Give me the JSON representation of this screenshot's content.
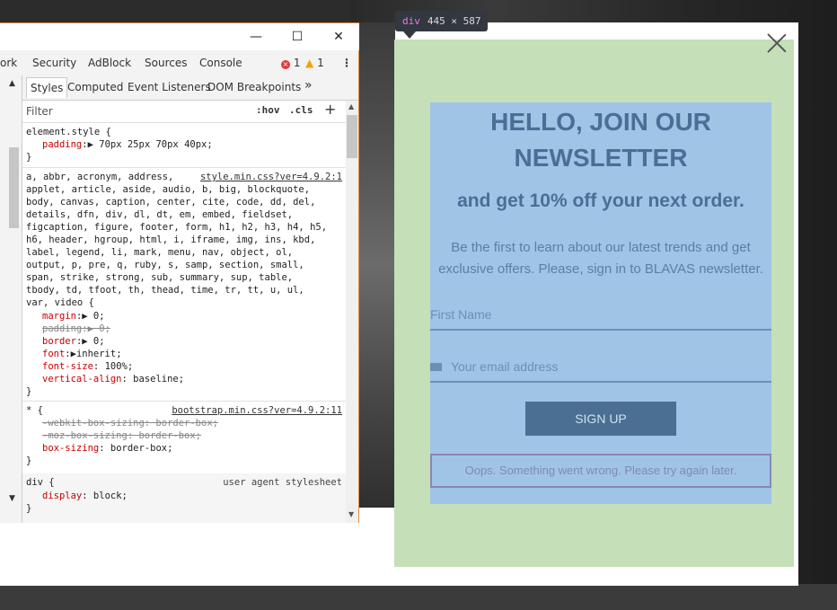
{
  "inspector": {
    "tag": "div",
    "dims": "445 × 587"
  },
  "newsletter": {
    "title_line1": "HELLO, JOIN OUR",
    "title_line2": "NEWSLETTER",
    "subtitle": "and get 10% off your next order.",
    "desc_line1": "Be the first to learn about our latest trends and get",
    "desc_line2": "exclusive offers. Please, sign in to BLAVAS newsletter.",
    "first_name_placeholder": "First Name",
    "email_placeholder": "Your email address",
    "signup_label": "SIGN UP",
    "error_message": "Oops. Something went wrong. Please try again later."
  },
  "devtools": {
    "window_buttons": {
      "minimize": "—",
      "maximize": "☐",
      "close": "✕"
    },
    "tabs": [
      "ork",
      "Security",
      "AdBlock",
      "Sources",
      "Console"
    ],
    "errors": "1",
    "warnings": "1",
    "subtabs": [
      "Styles",
      "Computed",
      "Event Listeners",
      "DOM Breakpoints"
    ],
    "more": "»",
    "filter_placeholder": "Filter",
    "hov": ":hov",
    "cls": ".cls",
    "plus": "+",
    "rules": {
      "element_selector": "element.style {",
      "element_prop": "padding",
      "element_val": " 70px 25px 70px 40px;",
      "close": "}",
      "reset_source": "style.min.css?ver=4.9.2:1",
      "reset_sel_lines": [
        "a, abbr, acronym, address,",
        "applet, article, aside, audio, b, big, blockquote,",
        "body, canvas, caption, center, cite, code, dd, del,",
        "details, dfn, div, dl, dt, em, embed, fieldset,",
        "figcaption, figure, footer, form, h1, h2, h3, h4, h5,",
        "h6, header, hgroup, html, i, iframe, img, ins, kbd,",
        "label, legend, li, mark, menu, nav, object, ol,",
        "output, p, pre, q, ruby, s, samp, section, small,",
        "span, strike, strong, sub, summary, sup, table,",
        "tbody, td, tfoot, th, thead, time, tr, tt, u, ul,",
        "var, video {"
      ],
      "reset_props": [
        {
          "name": "margin",
          "value": "0;"
        },
        {
          "name": "padding",
          "value": "0;"
        },
        {
          "name": "border",
          "value": "0;"
        },
        {
          "name": "font",
          "value": "inherit;"
        },
        {
          "name": "font-size",
          "value": "100%;"
        },
        {
          "name": "vertical-align",
          "value": "baseline;"
        }
      ],
      "star_selector": "* {",
      "star_source": "bootstrap.min.css?ver=4.9.2:11",
      "star_props": [
        "-webkit-box-sizing: border-box;",
        "-moz-box-sizing: border-box;"
      ],
      "star_box_prop": "box-sizing",
      "star_box_val": "border-box;",
      "div_selector": "div {",
      "div_source": "user agent stylesheet",
      "div_prop": "display",
      "div_val": "block;"
    }
  }
}
